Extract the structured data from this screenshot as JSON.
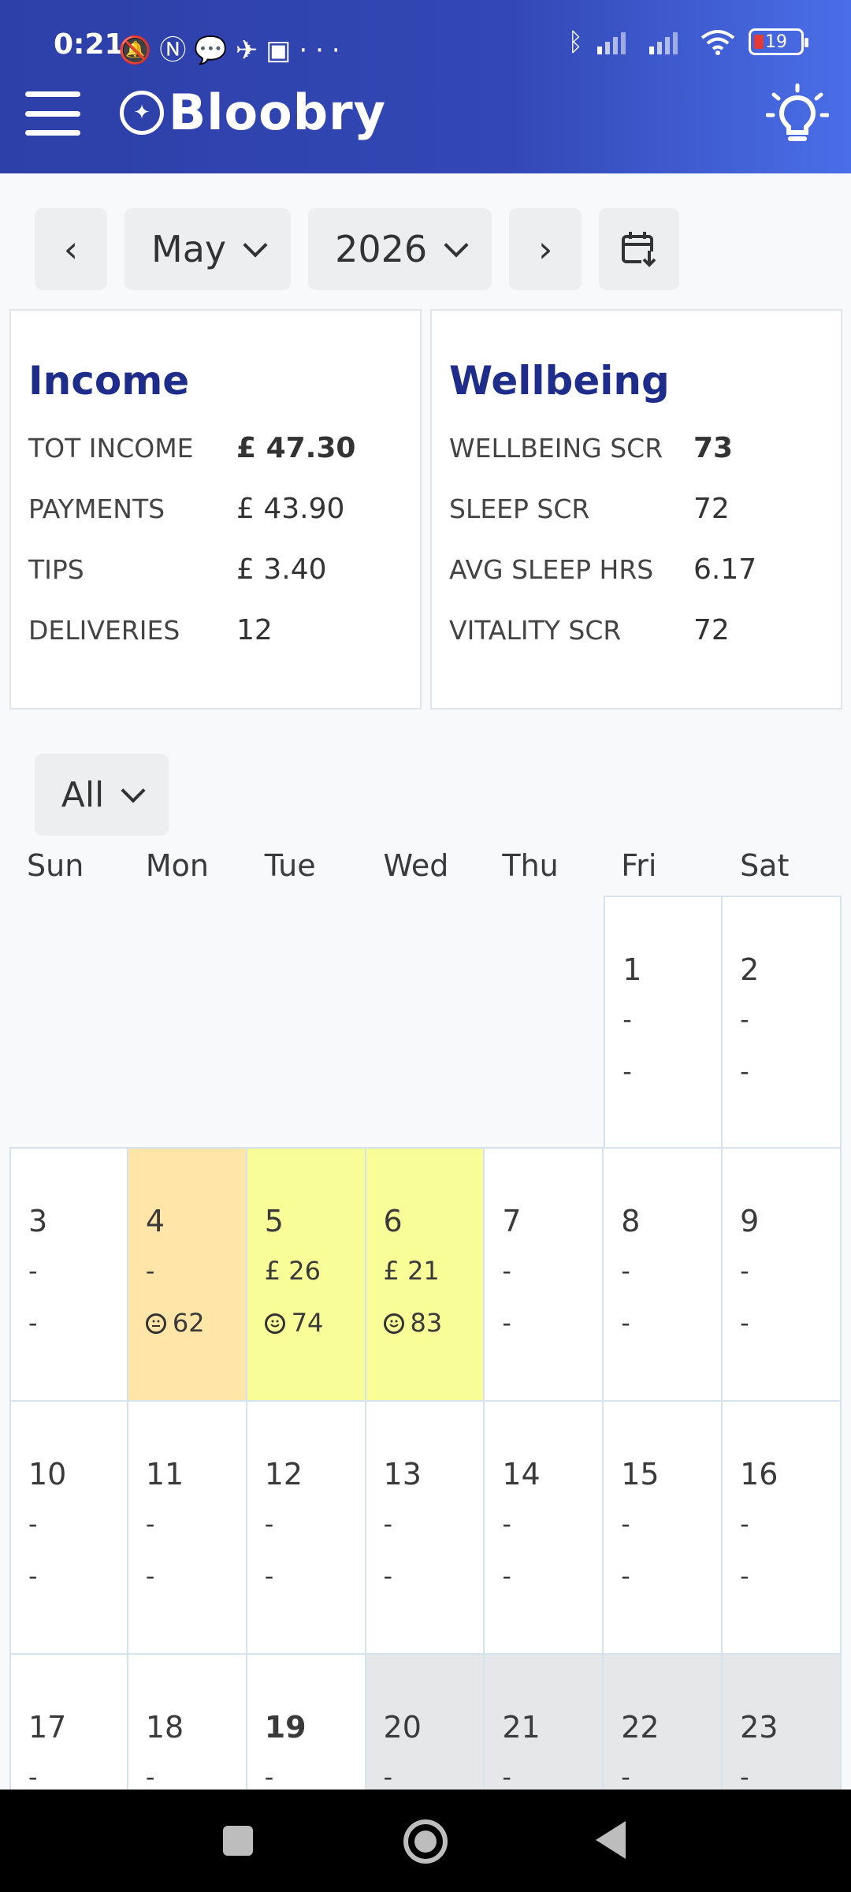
{
  "status_bar": {
    "time": "0:21",
    "battery": "19",
    "overflow": "···"
  },
  "app": {
    "name": "Bloobry"
  },
  "month_nav": {
    "month": "May",
    "year": "2026",
    "prev": "‹",
    "next": "›"
  },
  "income": {
    "title": "Income",
    "rows": [
      {
        "label": "TOT INCOME",
        "value": "£ 47.30"
      },
      {
        "label": "PAYMENTS",
        "value": "£ 43.90"
      },
      {
        "label": "TIPS",
        "value": "£ 3.40"
      },
      {
        "label": "DELIVERIES",
        "value": "12"
      }
    ]
  },
  "wellbeing": {
    "title": "Wellbeing",
    "rows": [
      {
        "label": "WELLBEING SCR",
        "value": "73"
      },
      {
        "label": "SLEEP SCR",
        "value": "72"
      },
      {
        "label": "AVG SLEEP HRS",
        "value": "6.17"
      },
      {
        "label": "VITALITY SCR",
        "value": "72"
      }
    ]
  },
  "filter": {
    "value": "All"
  },
  "calendar": {
    "weekdays": [
      "Sun",
      "Mon",
      "Tue",
      "Wed",
      "Thu",
      "Fri",
      "Sat"
    ],
    "weeks": [
      [
        null,
        null,
        null,
        null,
        null,
        {
          "day": "1",
          "income": "-",
          "score": "-"
        },
        {
          "day": "2",
          "income": "-",
          "score": "-"
        }
      ],
      [
        {
          "day": "3",
          "income": "-",
          "score": "-"
        },
        {
          "day": "4",
          "income": "-",
          "score": "62",
          "mood": "neutral",
          "color": "orange"
        },
        {
          "day": "5",
          "income": "£ 26",
          "score": "74",
          "mood": "happy",
          "color": "yellow"
        },
        {
          "day": "6",
          "income": "£ 21",
          "score": "83",
          "mood": "happy",
          "color": "yellow"
        },
        {
          "day": "7",
          "income": "-",
          "score": "-"
        },
        {
          "day": "8",
          "income": "-",
          "score": "-"
        },
        {
          "day": "9",
          "income": "-",
          "score": "-"
        }
      ],
      [
        {
          "day": "10",
          "income": "-",
          "score": "-"
        },
        {
          "day": "11",
          "income": "-",
          "score": "-"
        },
        {
          "day": "12",
          "income": "-",
          "score": "-"
        },
        {
          "day": "13",
          "income": "-",
          "score": "-"
        },
        {
          "day": "14",
          "income": "-",
          "score": "-"
        },
        {
          "day": "15",
          "income": "-",
          "score": "-"
        },
        {
          "day": "16",
          "income": "-",
          "score": "-"
        }
      ],
      [
        {
          "day": "17",
          "income": "-",
          "score": "-"
        },
        {
          "day": "18",
          "income": "-",
          "score": "-"
        },
        {
          "day": "19",
          "income": "-",
          "score": "-",
          "today": true
        },
        {
          "day": "20",
          "income": "-",
          "score": "-",
          "color": "grey"
        },
        {
          "day": "21",
          "income": "-",
          "score": "-",
          "color": "grey"
        },
        {
          "day": "22",
          "income": "-",
          "score": "-",
          "color": "grey"
        },
        {
          "day": "23",
          "income": "-",
          "score": "-",
          "color": "grey"
        }
      ]
    ]
  },
  "colors": {
    "header_start": "#2d3fa8",
    "header_end": "#4a6ee8",
    "title_blue": "#1f2d8a",
    "low_score": "#ffe5a8",
    "good_score": "#f8fd98",
    "future": "#e6e7e9"
  }
}
